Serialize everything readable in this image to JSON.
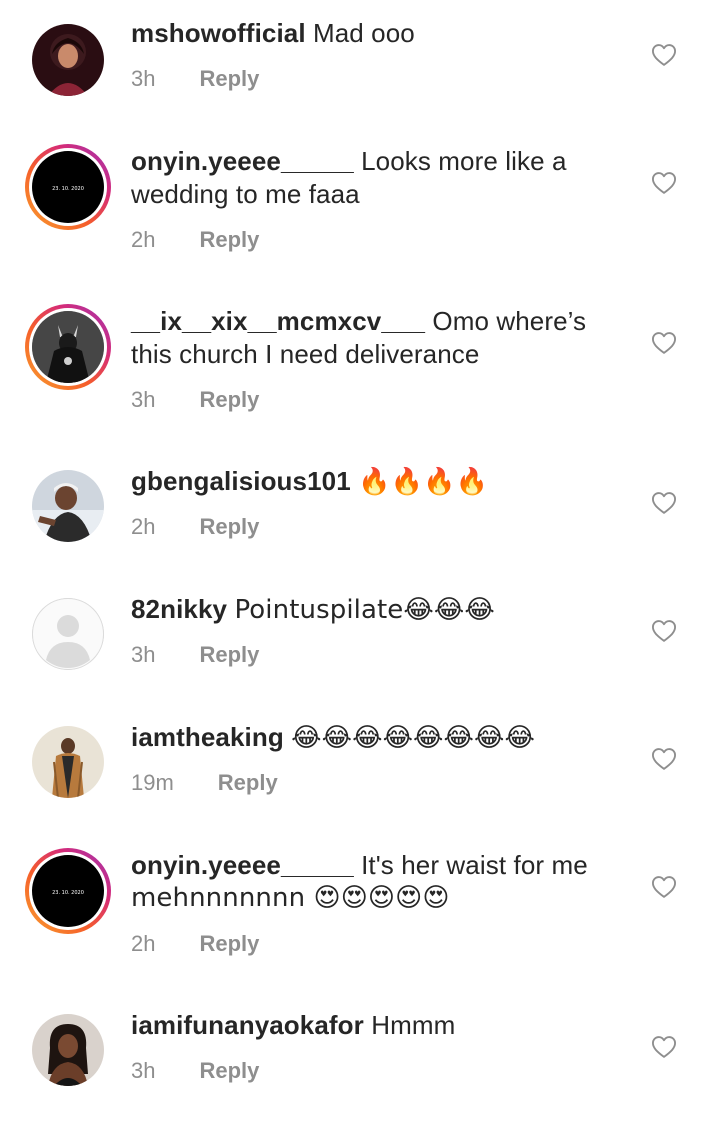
{
  "comments": [
    {
      "username": "mshowofficial",
      "text": "Mad ooo",
      "time": "3h",
      "reply": "Reply",
      "story": false
    },
    {
      "username": "onyin.yeeee_____",
      "text": "Looks more like a",
      "text2": "wedding to me faaa",
      "time": "2h",
      "reply": "Reply",
      "story": true,
      "avatar_caption": "23. 10. 2020"
    },
    {
      "username": "__ix__xix__mcmxcv___",
      "text": "Omo where’s",
      "text2": "this church I need deliverance",
      "time": "3h",
      "reply": "Reply",
      "story": true
    },
    {
      "username": "gbengalisious101",
      "text": "🔥🔥🔥🔥",
      "time": "2h",
      "reply": "Reply",
      "story": false
    },
    {
      "username": "82nikky",
      "text": "Pointuspilate😂😂😂",
      "time": "3h",
      "reply": "Reply",
      "story": false
    },
    {
      "username": "iamtheaking",
      "text": "😂😂😂😂😂😂😂😂",
      "time": "19m",
      "reply": "Reply",
      "story": false
    },
    {
      "username": "onyin.yeeee_____",
      "text": "It's her waist for me",
      "text2": "mehnnnnnnn 😍😍😍😍😍",
      "time": "2h",
      "reply": "Reply",
      "story": true,
      "avatar_caption": "23. 10. 2020"
    },
    {
      "username": "iamifunanyaokafor",
      "text": "Hmmm",
      "time": "3h",
      "reply": "Reply",
      "story": false
    }
  ],
  "icons": {
    "like": "heart-outline-icon"
  },
  "colors": {
    "text": "#262626",
    "meta": "#8e8e8e",
    "heart_stroke": "#8e8e8e"
  }
}
